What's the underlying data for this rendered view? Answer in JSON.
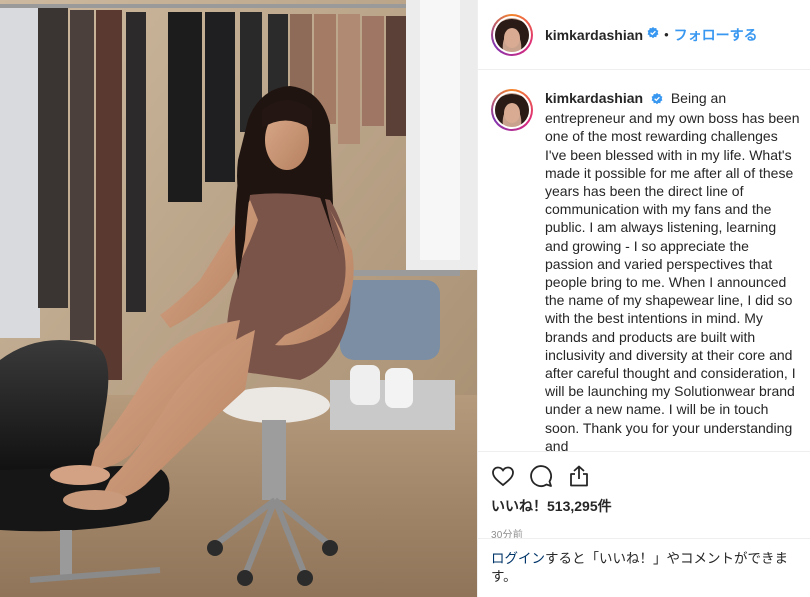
{
  "post": {
    "username": "kimkardashian",
    "follow_label": "フォローする",
    "dot": "•",
    "caption_user": "kimkardashian",
    "caption_body": "Being an entrepreneur and my own boss has been one of the most rewarding challenges I've been blessed with in my life. What's made it possible for me after all of these years has been the direct line of communication with my fans and the public. I am always listening, learning and growing - I so appreciate the passion and varied perspectives that people bring to me. When I announced the name of my shapewear line, I did so with the best intentions in mind. My brands and products are built with inclusivity and diversity at their core and after careful thought and consideration, I will be launching my Solutionwear brand under a new name. I will be in touch soon. Thank you for your understanding and",
    "likes": "いいね！513,295件",
    "time": "30分前",
    "login_link": "ログイン",
    "login_rest": "すると「いいね！」やコメントができます。"
  },
  "colors": {
    "accent": "#3897f0",
    "text": "#262626",
    "muted": "#8e8e8e",
    "border": "#efefef",
    "link": "#003569",
    "verified": "#3897f0"
  },
  "icons": {
    "like": "heart-icon",
    "comment": "comment-icon",
    "share": "share-icon",
    "verified": "verified-badge-icon"
  }
}
